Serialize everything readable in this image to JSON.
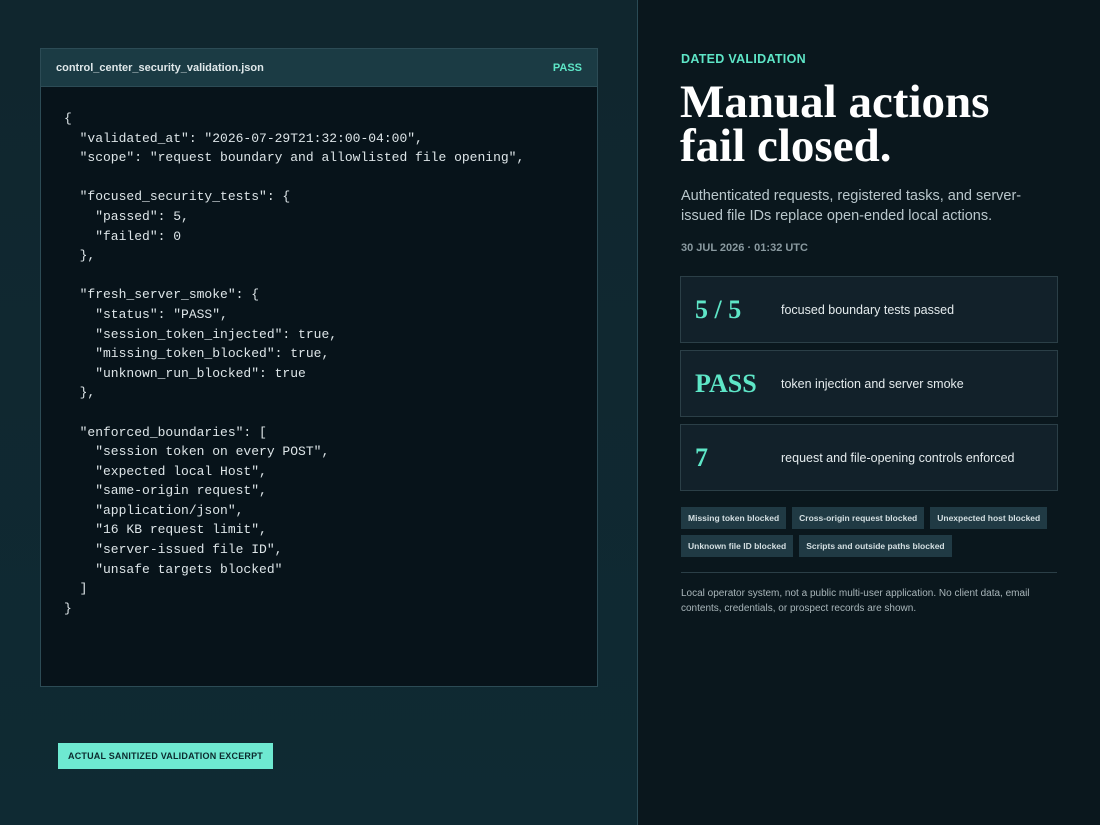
{
  "code_panel": {
    "filename": "control_center_security_validation.json",
    "status": "PASS",
    "lines": [
      "{",
      "  \"validated_at\": \"2026-07-29T21:32:00-04:00\",",
      "  \"scope\": \"request boundary and allowlisted file opening\",",
      "",
      "  \"focused_security_tests\": {",
      "    \"passed\": 5,",
      "    \"failed\": 0",
      "  },",
      "",
      "  \"fresh_server_smoke\": {",
      "    \"status\": \"PASS\",",
      "    \"session_token_injected\": true,",
      "    \"missing_token_blocked\": true,",
      "    \"unknown_run_blocked\": true",
      "  },",
      "",
      "  \"enforced_boundaries\": [",
      "    \"session token on every POST\",",
      "    \"expected local Host\",",
      "    \"same-origin request\",",
      "    \"application/json\",",
      "    \"16 KB request limit\",",
      "    \"server-issued file ID\",",
      "    \"unsafe targets blocked\"",
      "  ]",
      "}"
    ],
    "badge": "ACTUAL SANITIZED VALIDATION EXCERPT"
  },
  "summary": {
    "eyebrow": "DATED VALIDATION",
    "headline_line1": "Manual actions",
    "headline_line2": "fail closed.",
    "subhead": "Authenticated requests, registered tasks, and server-issued file IDs replace open-ended local actions.",
    "dateline": "30 JUL 2026 · 01:32 UTC",
    "stats": [
      {
        "value": "5 / 5",
        "label": "focused boundary tests passed"
      },
      {
        "value": "PASS",
        "label": "token injection and server smoke"
      },
      {
        "value": "7",
        "label": "request and file-opening controls enforced"
      }
    ],
    "chips": [
      "Missing token blocked",
      "Cross-origin request blocked",
      "Unexpected host blocked",
      "Unknown file ID blocked",
      "Scripts and outside paths blocked"
    ],
    "footnote": "Local operator system, not a public multi-user application. No client data, email contents, credentials, or prospect records are shown."
  },
  "colors": {
    "accent": "#5ee6c7",
    "badge_bg": "#6ee9d1",
    "panel_bg": "#07131a"
  }
}
